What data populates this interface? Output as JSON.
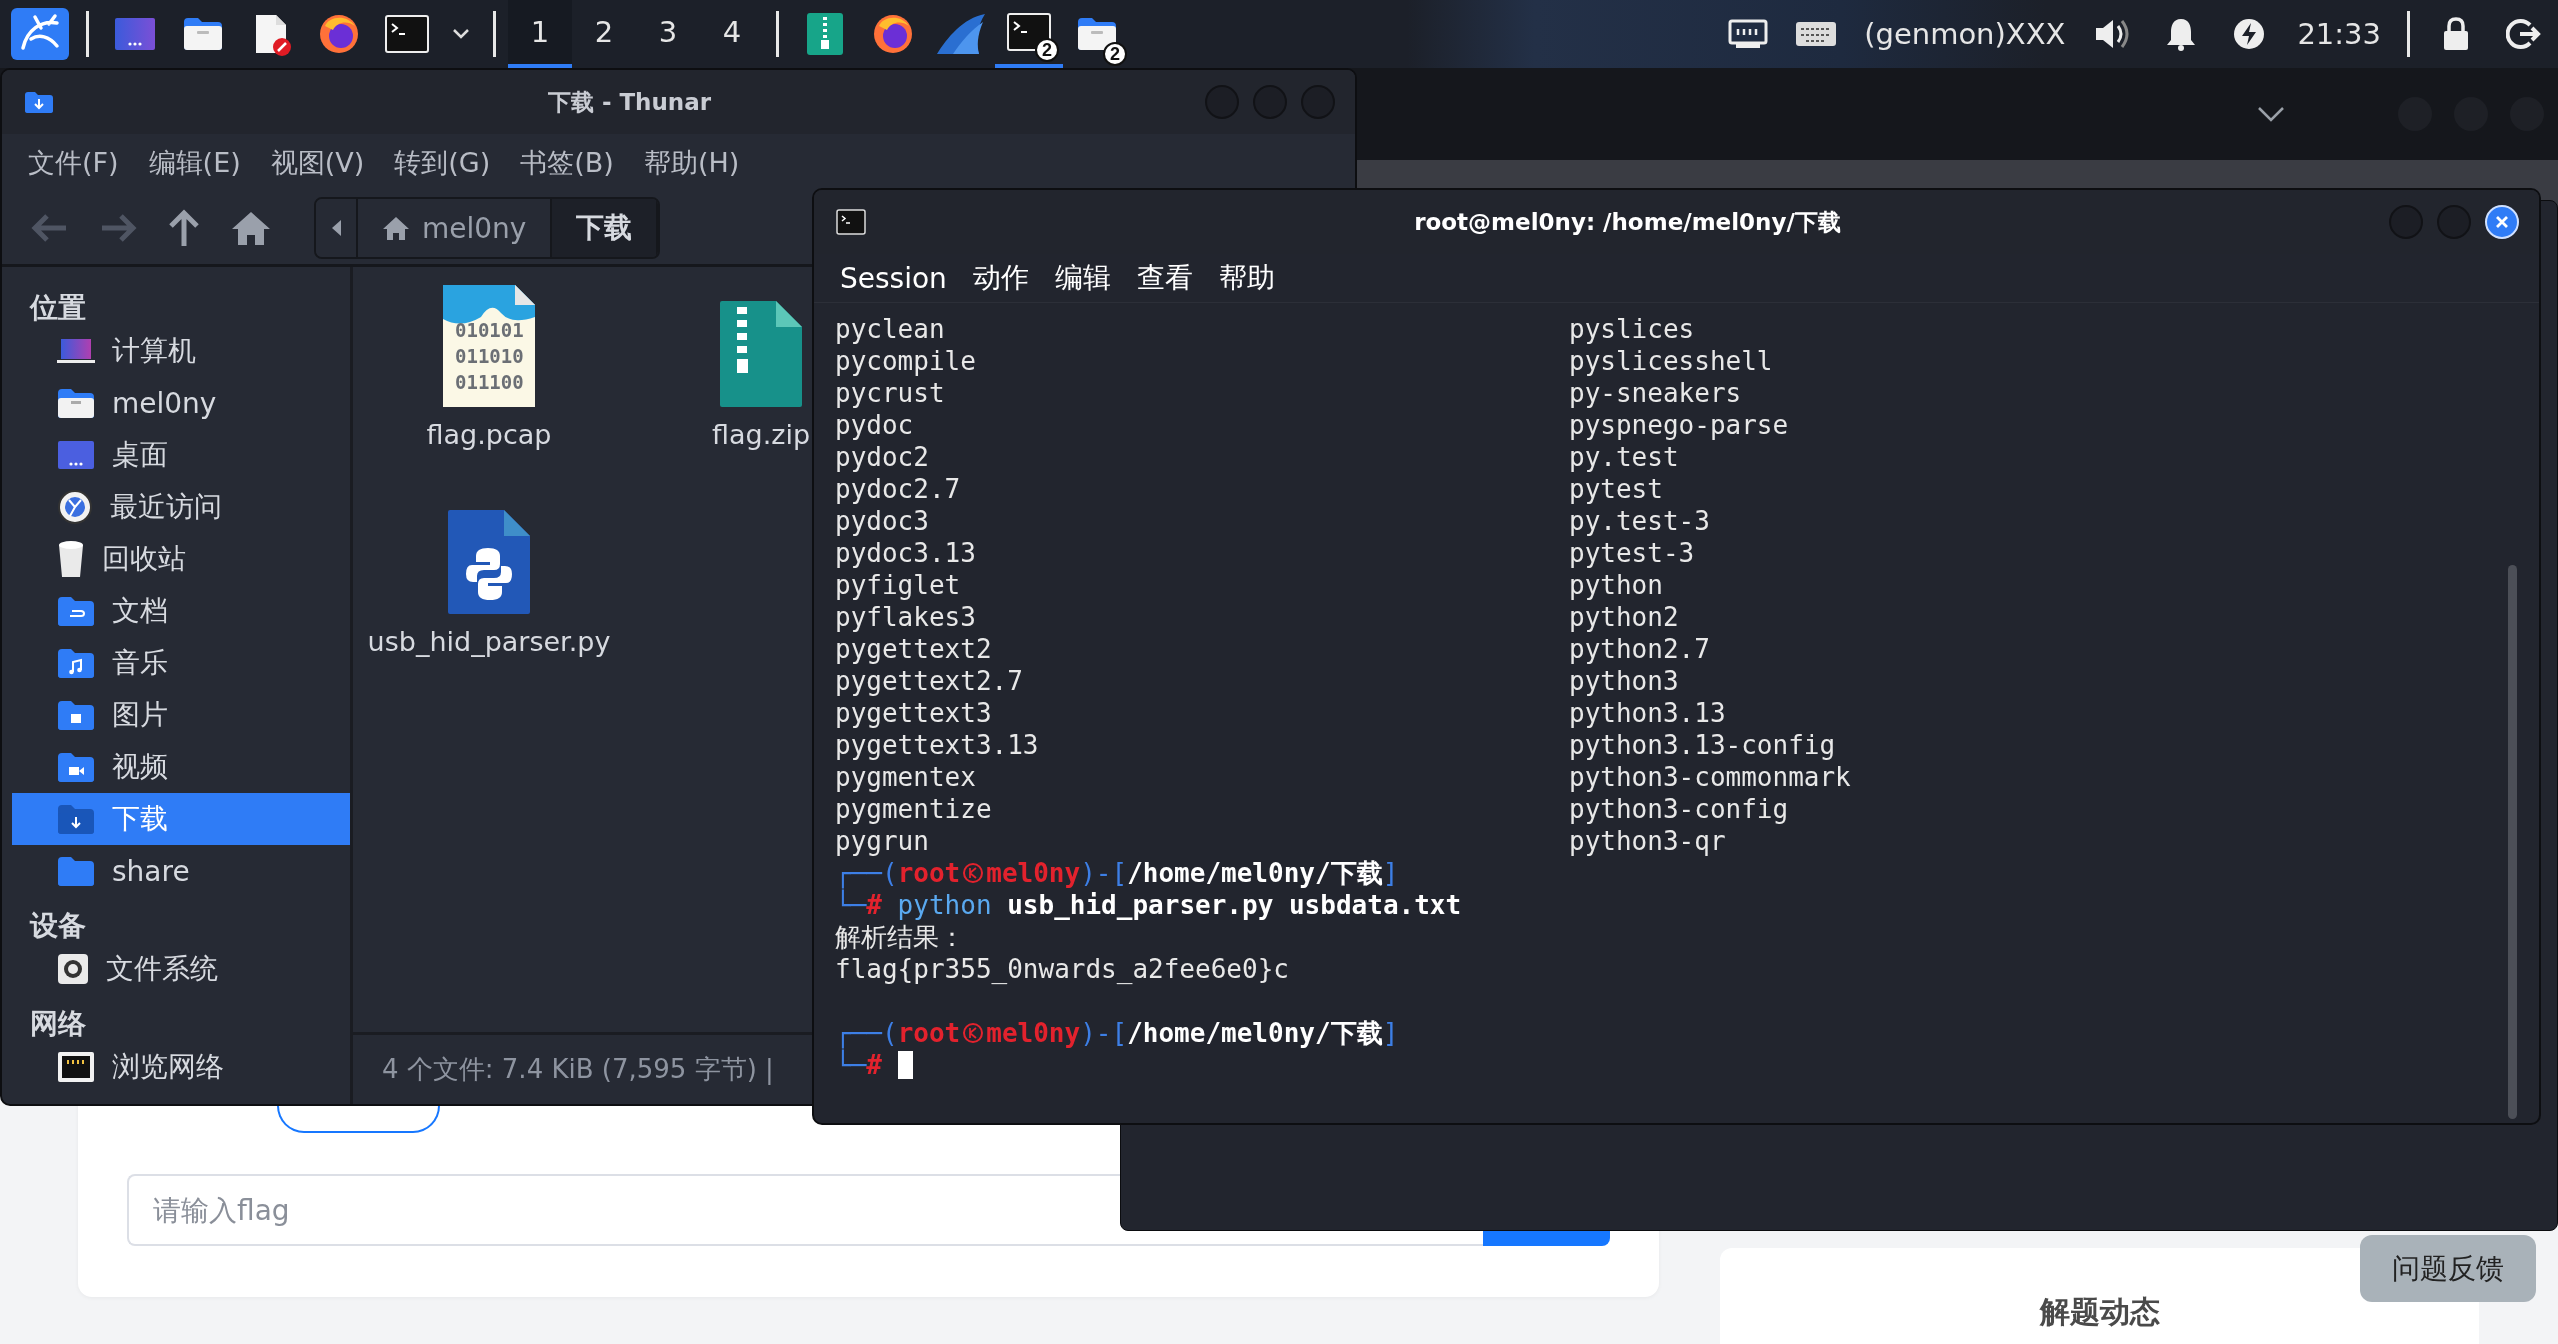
{
  "taskbar": {
    "launchers": [
      {
        "kind": "kali"
      },
      {
        "kind": "desktop"
      },
      {
        "kind": "files"
      },
      {
        "kind": "editor"
      },
      {
        "kind": "firefox"
      },
      {
        "kind": "terminal"
      },
      {
        "kind": "menu"
      }
    ],
    "workspaces": [
      {
        "label": "1",
        "selected": true
      },
      {
        "label": "2",
        "selected": false
      },
      {
        "label": "3",
        "selected": false
      },
      {
        "label": "4",
        "selected": false
      }
    ],
    "tasks": [
      {
        "kind": "archive",
        "active": false
      },
      {
        "kind": "firefox",
        "active": false
      },
      {
        "kind": "wireshark",
        "active": false
      },
      {
        "kind": "terminal",
        "badge": "2",
        "active": true
      },
      {
        "kind": "files",
        "badge": "2",
        "active": false
      }
    ],
    "tray": [
      {
        "kind": "network"
      },
      {
        "kind": "keyboard"
      },
      {
        "kind": "text",
        "label": "(genmon)XXX"
      },
      {
        "kind": "volume"
      },
      {
        "kind": "bell"
      },
      {
        "kind": "power"
      },
      {
        "kind": "clock",
        "label": "21:33"
      },
      {
        "kind": "separator"
      },
      {
        "kind": "lock"
      },
      {
        "kind": "logout"
      }
    ]
  },
  "browser": {
    "page": {
      "flag_input": {
        "placeholder": "请输入flag"
      },
      "feedback_button": "问题反馈",
      "activity_card": {
        "title": "解题动态"
      }
    }
  },
  "thunar": {
    "title": "下载 - Thunar",
    "focused": false,
    "menu": [
      "文件(F)",
      "编辑(E)",
      "视图(V)",
      "转到(G)",
      "书签(B)",
      "帮助(H)"
    ],
    "path": [
      {
        "label": "mel0ny",
        "kind": "home",
        "selected": false
      },
      {
        "label": "下载",
        "kind": "folder",
        "selected": true
      }
    ],
    "sidebar": [
      {
        "heading": "位置",
        "items": [
          {
            "label": "计算机",
            "kind": "computer",
            "selected": false
          },
          {
            "label": "mel0ny",
            "kind": "home",
            "selected": false
          },
          {
            "label": "桌面",
            "kind": "desktop",
            "selected": false
          },
          {
            "label": "最近访问",
            "kind": "recent",
            "selected": false
          },
          {
            "label": "回收站",
            "kind": "trash",
            "selected": false
          },
          {
            "label": "文档",
            "kind": "documents",
            "selected": false
          },
          {
            "label": "音乐",
            "kind": "music",
            "selected": false
          },
          {
            "label": "图片",
            "kind": "pictures",
            "selected": false
          },
          {
            "label": "视频",
            "kind": "videos",
            "selected": false
          },
          {
            "label": "下载",
            "kind": "downloads",
            "selected": true
          },
          {
            "label": "share",
            "kind": "folder",
            "selected": false
          }
        ]
      },
      {
        "heading": "设备",
        "items": [
          {
            "label": "文件系统",
            "kind": "drive",
            "selected": false
          }
        ]
      },
      {
        "heading": "网络",
        "items": [
          {
            "label": "浏览网络",
            "kind": "network",
            "selected": false
          }
        ]
      }
    ],
    "files": [
      {
        "name": "flag.pcap",
        "kind": "pcap",
        "icon_text": [
          "010101",
          "011010",
          "011100"
        ]
      },
      {
        "name": "flag.zip",
        "kind": "zip"
      },
      {
        "name": "usb_hid_parser.py",
        "kind": "python"
      }
    ],
    "status": "4 个文件: 7.4 KiB (7,595 字节) |"
  },
  "terminal": {
    "title": "root@mel0ny: /home/mel0ny/下载",
    "focused": true,
    "menu": [
      "Session",
      "动作",
      "编辑",
      "查看",
      "帮助"
    ],
    "columns": [
      [
        "pyclean",
        "pycompile",
        "pycrust",
        "pydoc",
        "pydoc2",
        "pydoc2.7",
        "pydoc3",
        "pydoc3.13",
        "pyfiglet",
        "pyflakes3",
        "pygettext2",
        "pygettext2.7",
        "pygettext3",
        "pygettext3.13",
        "pygmentex",
        "pygmentize",
        "pygrun"
      ],
      [
        "pyslices",
        "pyslicesshell",
        "py-sneakers",
        "pyspnego-parse",
        "py.test",
        "pytest",
        "py.test-3",
        "pytest-3",
        "python",
        "python2",
        "python2.7",
        "python3",
        "python3.13",
        "python3.13-config",
        "python3-commonmark",
        "python3-config",
        "python3-qr"
      ]
    ],
    "lines": [
      {
        "kind": "prompt",
        "open": "┌──(",
        "user": "root",
        "host": "mel0ny",
        "mid": ")-[",
        "path": "/home/mel0ny/下载",
        "close": "]"
      },
      {
        "kind": "command",
        "frame": "└─",
        "sign": "#",
        "program": "python",
        "args": "usb_hid_parser.py usbdata.txt"
      },
      {
        "kind": "output",
        "text": "解析结果："
      },
      {
        "kind": "output",
        "text": "flag{pr355_0nwards_a2fee6e0}c"
      },
      {
        "kind": "blank"
      },
      {
        "kind": "prompt",
        "open": "┌──(",
        "user": "root",
        "host": "mel0ny",
        "mid": ")-[",
        "path": "/home/mel0ny/下载",
        "close": "]"
      },
      {
        "kind": "command",
        "frame": "└─",
        "sign": "#",
        "cursor": true
      }
    ]
  }
}
